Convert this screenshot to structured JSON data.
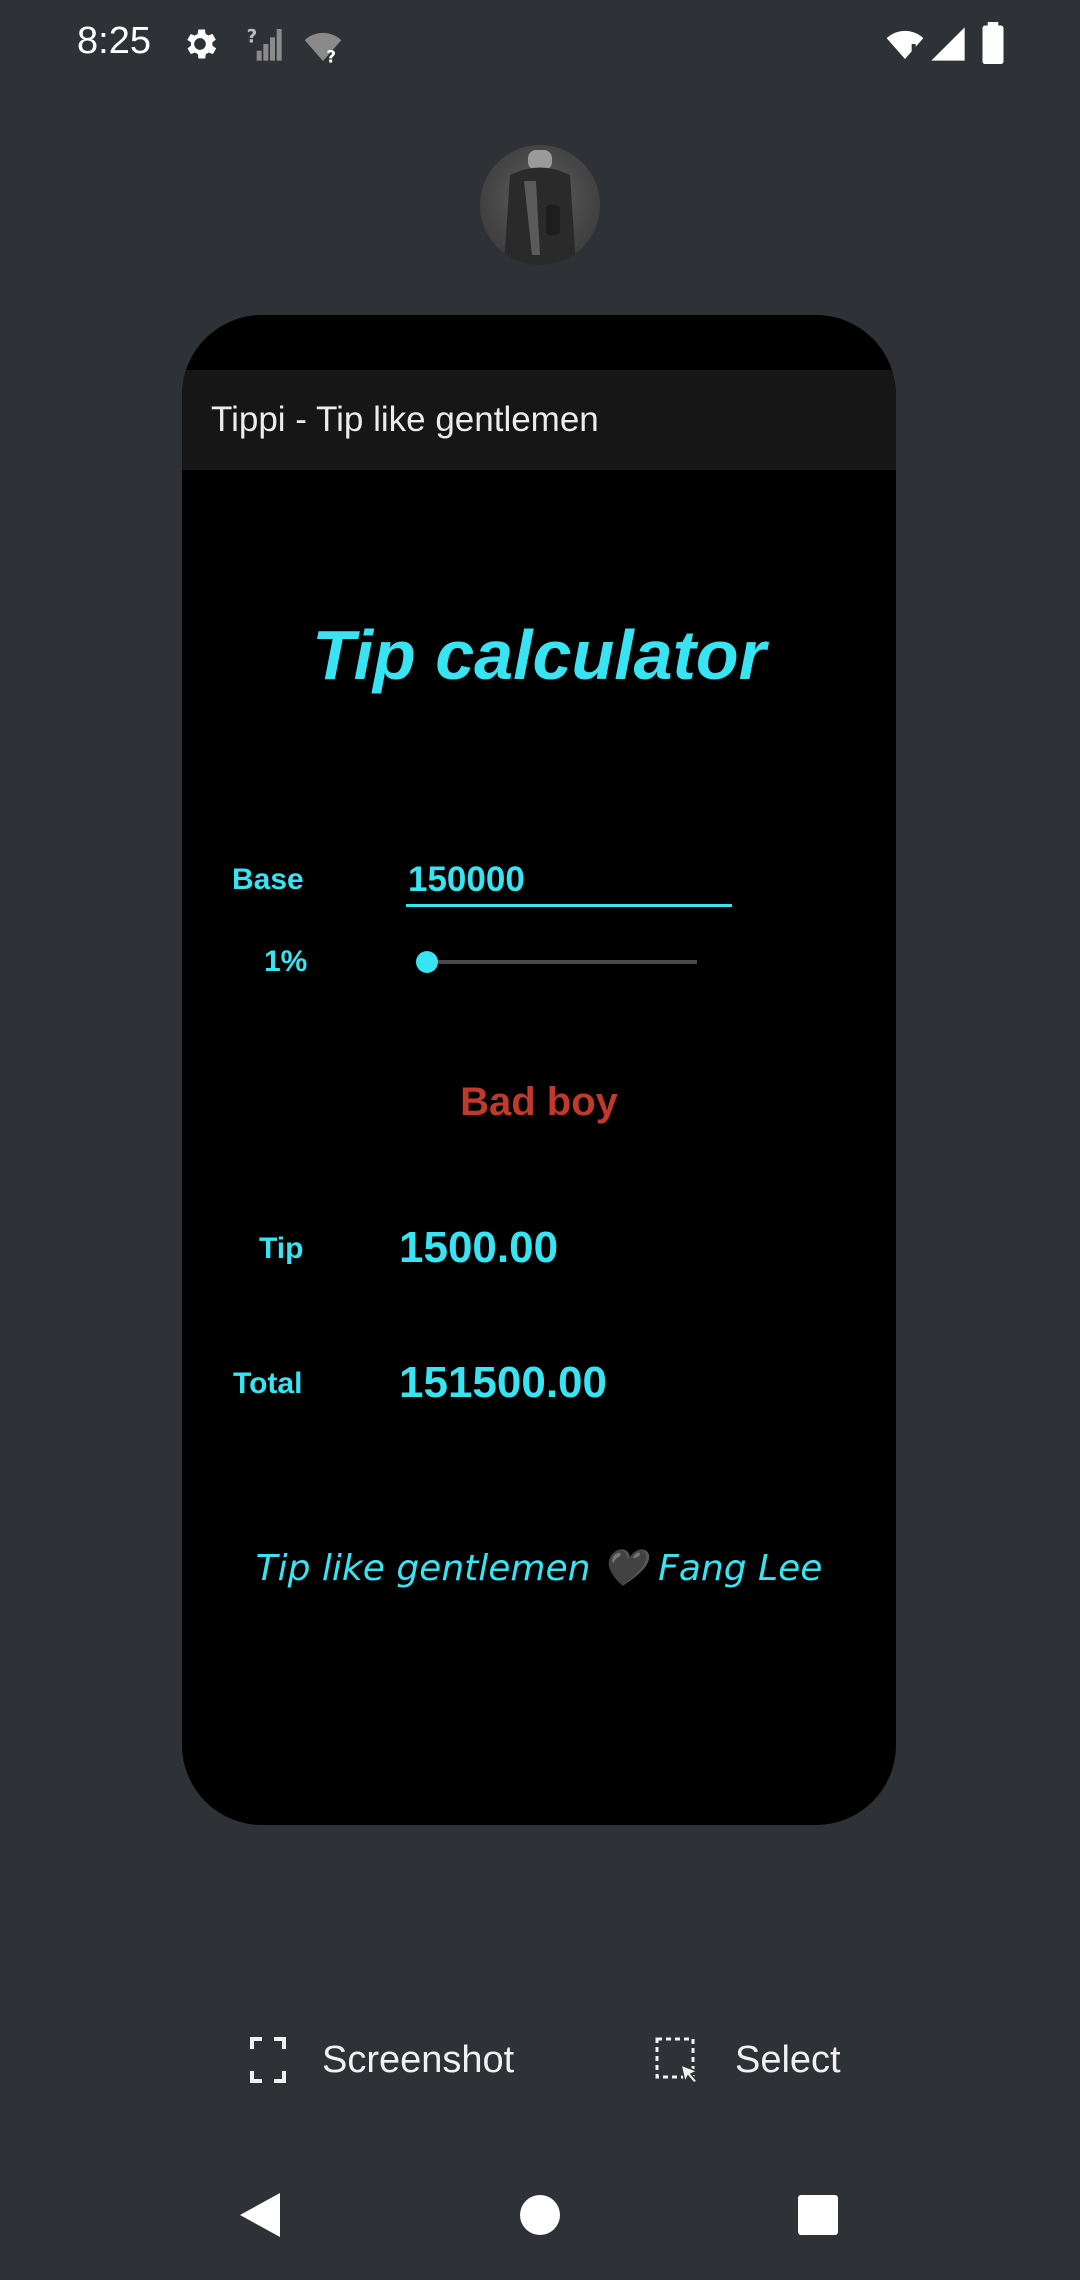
{
  "status_bar": {
    "time": "8:25"
  },
  "app": {
    "title": "Tippi - Tip like gentlemen",
    "heading": "Tip calculator",
    "base": {
      "label": "Base",
      "value": "150000"
    },
    "percent": {
      "label": "1%",
      "slider_fraction": 0.0
    },
    "verdict": "Bad boy",
    "tip": {
      "label": "Tip",
      "value": "1500.00"
    },
    "total": {
      "label": "Total",
      "value": "151500.00"
    },
    "footer": {
      "text_before": "Tip like gentlemen ",
      "heart": "🖤",
      "text_after": " Fang Lee"
    }
  },
  "recents": {
    "screenshot_label": "Screenshot",
    "select_label": "Select"
  },
  "colors": {
    "accent": "#38e4f2",
    "verdict": "#c0392b",
    "background": "#2e3135",
    "card": "#000000"
  }
}
